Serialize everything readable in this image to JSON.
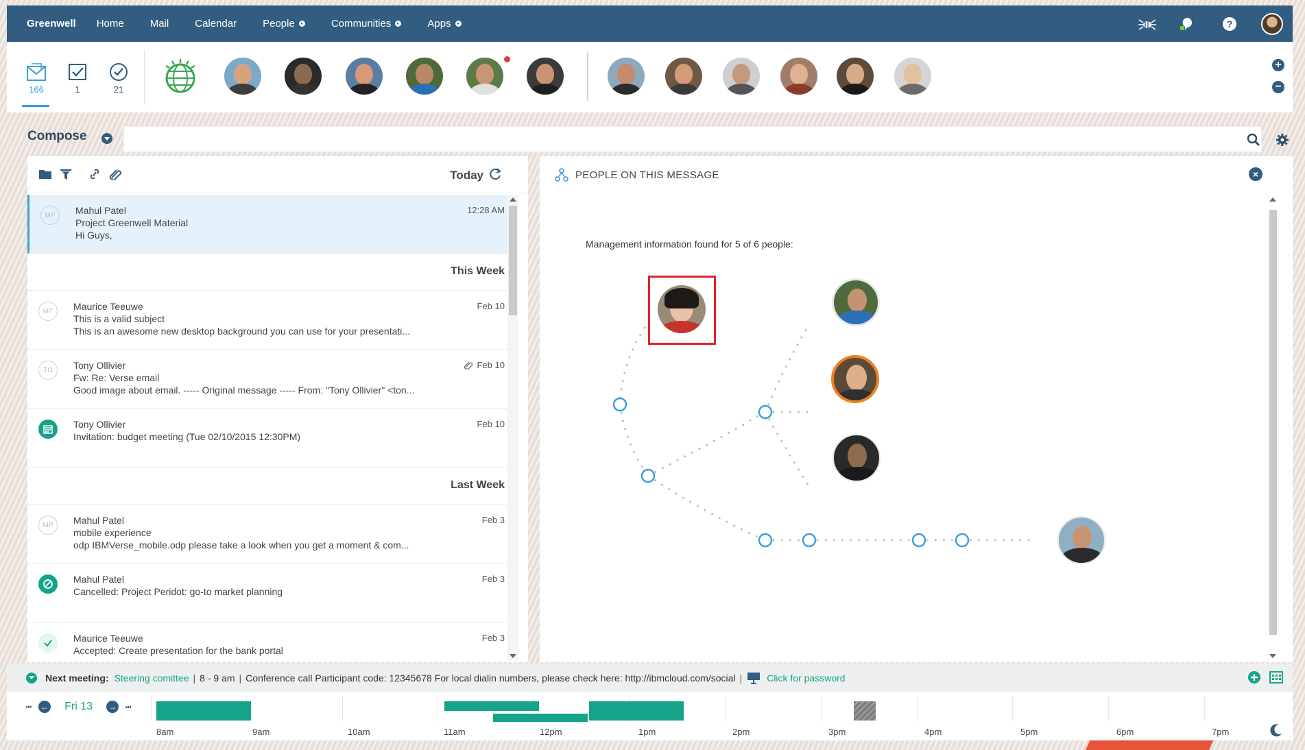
{
  "topnav": {
    "brand": "Greenwell",
    "items": [
      "Home",
      "Mail",
      "Calendar",
      "People",
      "Communities",
      "Apps"
    ],
    "dropdown_items": [
      "People",
      "Communities",
      "Apps"
    ]
  },
  "counters": [
    {
      "name": "inbox",
      "value": "166"
    },
    {
      "name": "todo",
      "value": "1"
    },
    {
      "name": "waiting",
      "value": "21"
    }
  ],
  "compose": {
    "label": "Compose",
    "search_value": ""
  },
  "mail_toolbar": {
    "today_label": "Today"
  },
  "mail_list": {
    "selected": {
      "avatar": "MP",
      "sender": "Mahul Patel",
      "subject": "Project Greenwell Material",
      "preview": "Hi Guys,",
      "date": "12:28 AM"
    },
    "sections": [
      {
        "title": "This Week",
        "rows": [
          {
            "avatar": "MT",
            "sender": "Maurice Teeuwe",
            "subject": "This is a valid subject",
            "preview": "This is an awesome new desktop background you can use for your presentati...",
            "date": "Feb 10"
          },
          {
            "avatar": "TO",
            "sender": "Tony Ollivier",
            "subject": "Fw: Re: Verse email",
            "preview": "Good image about email. ----- Original message ----- From: \"Tony Ollivier\" <ton...",
            "date": "Feb 10"
          },
          {
            "avatar": "cal",
            "sender": "Tony Ollivier",
            "subject": "Invitation: budget meeting (Tue 02/10/2015 12:30PM)",
            "preview": "",
            "date": "Feb 10"
          }
        ]
      },
      {
        "title": "Last Week",
        "rows": [
          {
            "avatar": "MP",
            "sender": "Mahul Patel",
            "subject": "mobile experience",
            "preview": " odp IBMVerse_mobile.odp  please take a look when you get a moment & com...",
            "date": "Feb 3"
          },
          {
            "avatar": "cancel",
            "sender": "Mahul Patel",
            "subject": "Cancelled: Project Peridot: go-to market planning",
            "preview": "",
            "date": "Feb 3"
          },
          {
            "avatar": "accept",
            "sender": "Maurice Teeuwe",
            "subject": "Accepted: Create presentation for the bank portal",
            "preview": "",
            "date": "Feb 3"
          }
        ]
      }
    ]
  },
  "people_panel": {
    "title": "PEOPLE ON THIS MESSAGE",
    "info": "Management information found for 5 of 6 people:"
  },
  "meeting_bar": {
    "label": "Next meeting:",
    "meeting_name": "Steering comittee",
    "time": "8 - 9 am",
    "details": "Conference call Participant code: 12345678 For local dialin numbers, please check here: http://ibmcloud.com/social",
    "password_link": "Click for password"
  },
  "timeline": {
    "date": "Fri 13",
    "hours": [
      "8am",
      "9am",
      "10am",
      "11am",
      "12pm",
      "1pm",
      "2pm",
      "3pm",
      "4pm",
      "5pm",
      "6pm",
      "7pm"
    ]
  },
  "colors": {
    "nav": "#325c80",
    "accent": "#3b9ed9",
    "teal": "#16a38a",
    "highlight": "#e2212b"
  }
}
